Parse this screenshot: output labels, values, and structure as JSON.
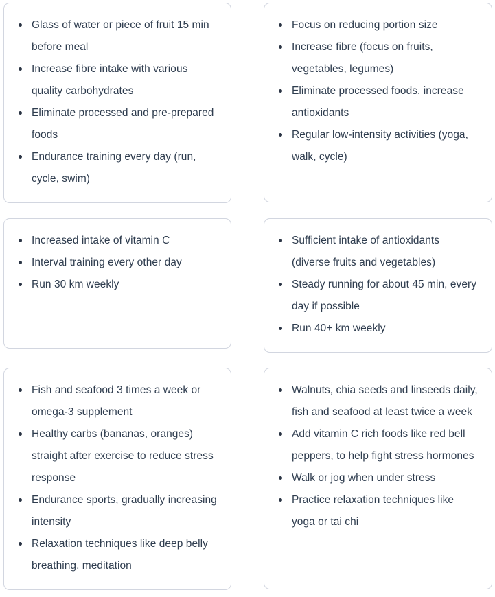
{
  "page": {
    "background_color": "#ffffff",
    "card_border_color": "#d2d6e0",
    "text_color": "#2f3d4f",
    "bullet_color": "#2b3545"
  },
  "cards": [
    {
      "position": "row1-left",
      "items": [
        "Glass of water or piece of fruit 15 min before meal",
        "Increase fibre intake with various quality carbohydrates",
        "Eliminate processed and pre-prepared foods",
        "Endurance training every day (run, cycle, swim)"
      ]
    },
    {
      "position": "row1-right",
      "items": [
        "Focus on reducing portion size",
        "Increase fibre (focus on fruits, vegetables, legumes)",
        "Eliminate processed foods, increase antioxidants",
        "Regular low-intensity activities (yoga, walk, cycle)"
      ]
    },
    {
      "position": "row2-left",
      "items": [
        "Increased intake of vitamin C",
        "Interval training every other day",
        "Run 30 km weekly"
      ]
    },
    {
      "position": "row2-right",
      "items": [
        "Sufficient intake of antioxidants (diverse fruits and vegetables)",
        "Steady running for about 45 min, every day if possible",
        "Run 40+ km weekly"
      ]
    },
    {
      "position": "row3-left",
      "items": [
        "Fish and seafood 3 times a week or omega-3 supplement",
        "Healthy carbs (bananas, oranges) straight after exercise to reduce stress response",
        "Endurance sports, gradually increasing intensity",
        "Relaxation techniques like deep belly breathing, meditation"
      ]
    },
    {
      "position": "row3-right",
      "items": [
        "Walnuts, chia seeds and linseeds daily, fish and seafood at least twice a week",
        "Add vitamin C rich foods like red bell peppers, to help fight stress hormones",
        "Walk or jog when under stress",
        "Practice relaxation techniques like yoga or tai chi"
      ]
    }
  ]
}
